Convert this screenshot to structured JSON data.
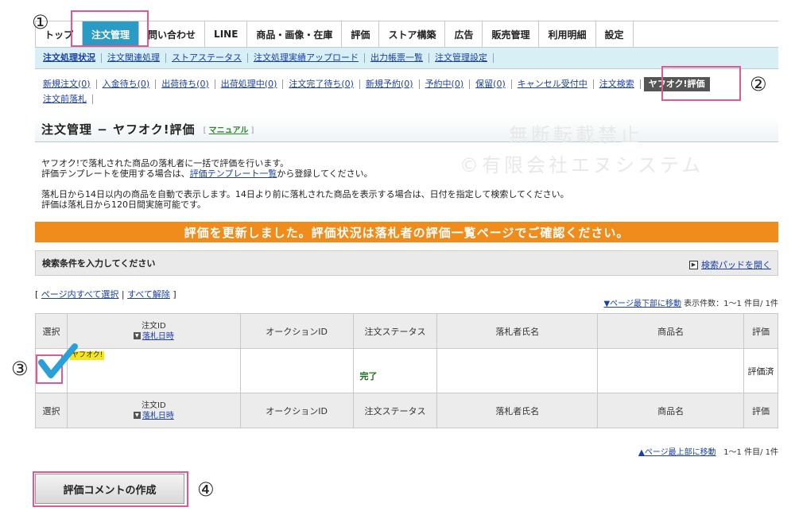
{
  "nav": {
    "tabs": [
      "トップ",
      "注文管理",
      "問い合わせ",
      "LINE",
      "商品・画像・在庫",
      "評価",
      "ストア構築",
      "広告",
      "販売管理",
      "利用明細",
      "設定"
    ]
  },
  "subnav": {
    "items": [
      "注文処理状況",
      "注文関連処理",
      "ストアステータス",
      "注文処理実績アップロード",
      "出力帳票一覧",
      "注文管理設定"
    ]
  },
  "thirdnav": {
    "row1": [
      "新規注文(0)",
      "入金待ち(0)",
      "出荷待ち(0)",
      "出荷処理中(0)",
      "注文完了待ち(0)",
      "新規予約(0)",
      "予約中(0)",
      "保留(0)",
      "キャンセル受付中",
      "注文検索",
      "ヤフオク!評価"
    ],
    "row2": [
      "注文前落札"
    ]
  },
  "page": {
    "title": "注文管理 − ヤフオク!評価",
    "manual_link": "マニュアル",
    "watermark1": "無断転載禁止",
    "watermark2": "©有限会社エヌシステム"
  },
  "desc": {
    "line1": "ヤフオク!で落札された商品の落札者に一括で評価を行います。",
    "line2a": "評価テンプレートを使用する場合は、",
    "line2link": "評価テンプレート一覧",
    "line2b": "から登録してください。",
    "line3": "落札日から14日以内の商品を自動で表示します。14日より前に落札された商品を表示する場合は、日付を指定して検索してください。",
    "line4": "評価は落札日から120日間実施可能です。"
  },
  "banner": {
    "text": "評価を更新しました。評価状況は落札者の評価一覧ページでご確認ください。"
  },
  "search": {
    "label": "検索条件を入力してください",
    "toggle": "検索パッドを開く"
  },
  "selection": {
    "select_all": "ページ内すべて選択",
    "clear_all": "すべて解除"
  },
  "pager": {
    "to_bottom": "▼ページ最下部に移動",
    "count_label": "表示件数：1〜1 件目/ 1件",
    "to_top": "▲ページ最上部に移動",
    "count_bottom": "1〜1 件目/ 1件"
  },
  "table": {
    "headers": {
      "select": "選択",
      "order_id": "注文ID",
      "bid_date": "落札日時",
      "auction_id": "オークションID",
      "status": "注文ステータス",
      "bidder": "落札者氏名",
      "product": "商品名",
      "rating": "評価"
    },
    "rows": [
      {
        "badge": "ヤフオク!",
        "status": "完了",
        "rating": "評価済"
      }
    ]
  },
  "actions": {
    "create_comment": "評価コメントの作成"
  },
  "annotations": {
    "n1": "①",
    "n2": "②",
    "n3": "③",
    "n4": "④"
  },
  "colors": {
    "accent": "#2a9bc4",
    "banner": "#f08c1b",
    "highlight": "#e2588f"
  }
}
